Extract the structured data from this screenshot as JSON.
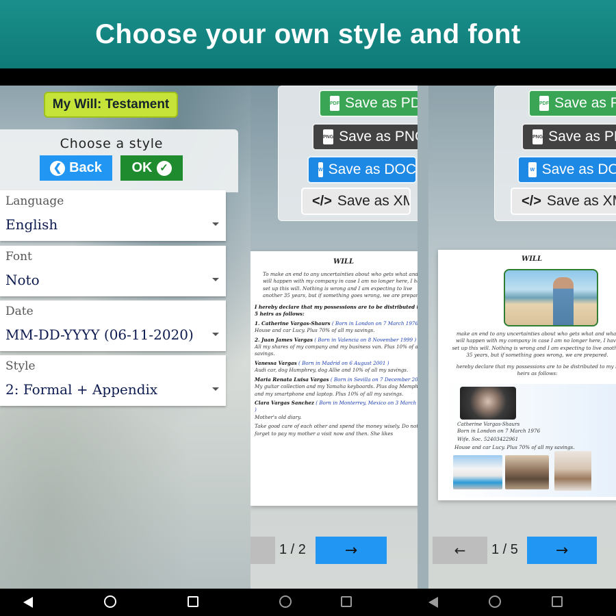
{
  "banner": {
    "title": "Choose your own style and font"
  },
  "left_screen": {
    "app_title": "My Will: Testament",
    "style_panel": {
      "title": "Choose a style",
      "back_label": "Back",
      "ok_label": "OK"
    },
    "fields": [
      {
        "label": "Language",
        "value": "English"
      },
      {
        "label": "Font",
        "value": "Noto"
      },
      {
        "label": "Date",
        "value": "MM-DD-YYYY (06-11-2020)"
      },
      {
        "label": "Style",
        "value": "2: Formal + Appendix"
      }
    ]
  },
  "save_buttons": {
    "pdf": "Save as PDF",
    "png": "Save as PNG",
    "doc": "Save as DOC",
    "xml": "Save as XML"
  },
  "middle_screen": {
    "doc_title": "WILL",
    "intro": "To make an end to any uncertainties about who gets what and what will happen with my company in case I am no longer here, I have set up this will. Nothing is wrong and I am expecting to live another 35 years, but if something goes wrong, we are prepared.",
    "declaration": "I hereby declare that my possessions are to be distributed to my 5 heirs as follows:",
    "heirs": [
      {
        "name": "1. Catherine Vargas-Shaurs",
        "born": "( Born in London on 7 March 1976 )",
        "text": "House and car Lucy. Plus 70% of all my savings."
      },
      {
        "name": "2. Juan James Vargas",
        "born": "( Born in Valencia on 8 November 1999 )",
        "text": "All my shares of my company and my business van. Plus 10% of all my savings."
      },
      {
        "name": "Vanessa Vargas",
        "born": "( Born in Madrid on 6 August 2001 )",
        "text": "Audi car, dog Humphrey, dog Allie and 10% of all my savings."
      },
      {
        "name": "Maria Renata Luisa Vargas",
        "born": "( Born in Sevilla on 7 December 2005 )",
        "text": "My guitar collection and my Yamaha keyboards. Plus dog Memphis and my smartphone and laptop. Plus 10% of all my savings."
      },
      {
        "name": "Clara Vargas Sanchez",
        "born": "( Born in Monterrey, Mexico on 3 March 1971 )",
        "text": "Mother's old diary."
      }
    ],
    "closing": "Take good care of each other and spend the money wisely. Do not forget to pay my mother a visit now and then. She likes",
    "page_indicator": "1 / 2"
  },
  "right_screen": {
    "doc_title": "WILL",
    "intro": "make an end to any uncertainties about who gets what and what will happen with my company in case I am no longer here, I have set up this will. Nothing is wrong and I am expecting to live another 35 years, but if something goes wrong, we are prepared.",
    "declaration": "hereby declare that my possessions are to be distributed to my 5 heirs as follows:",
    "heir_name": "Catherine Vargas-Shaurs",
    "heir_born": "Born in London on 7 March 1976",
    "heir_ssn": "Wife. Soc. 52403422961",
    "heir_text": "House and car Lucy. Plus 70% of all my savings.",
    "page_indicator": "1 / 5"
  },
  "icons": {
    "back": "arrow-left-circle-icon",
    "ok": "check-circle-icon",
    "pdf": "pdf-file-icon",
    "png": "png-file-icon",
    "doc": "doc-file-icon",
    "xml": "code-icon",
    "prev": "arrow-left-icon",
    "next": "arrow-right-icon"
  },
  "colors": {
    "banner": "#0f7b78",
    "chip": "#c6e33a",
    "back": "#2196f3",
    "ok": "#1e8c2e",
    "pdf": "#3aa655",
    "png": "#424242",
    "doc": "#1e88e5"
  }
}
